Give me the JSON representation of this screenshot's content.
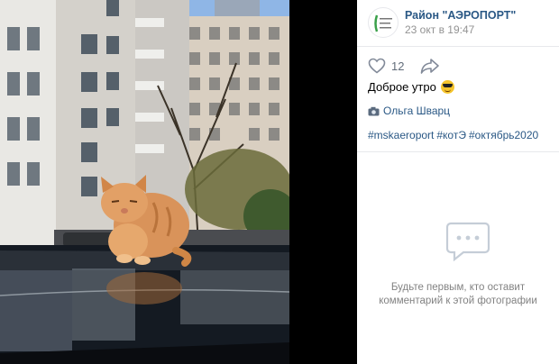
{
  "group": {
    "name": "Район \"АЭРОПОРТ\"",
    "date": "23 окт в 19:47",
    "avatar_icon": "district-logo-icon"
  },
  "actions": {
    "like_icon": "heart-icon",
    "like_count": "12",
    "share_icon": "share-arrow-icon"
  },
  "post": {
    "caption": "Доброе утро",
    "caption_emoji": "sunglasses-emoji-icon",
    "author_icon": "camera-icon",
    "author": "Ольга Шварц",
    "tags": [
      "#mskaeroport",
      "#котЭ",
      "#октябрь2020"
    ]
  },
  "comments": {
    "empty_icon": "comments-bubble-icon",
    "empty_text": "Будьте первым, кто оставит комментарий к этой фотографии"
  },
  "colors": {
    "link": "#2a5885",
    "muted": "#939393",
    "divider": "#e7e8ec",
    "viewer_bg": "#000000"
  }
}
